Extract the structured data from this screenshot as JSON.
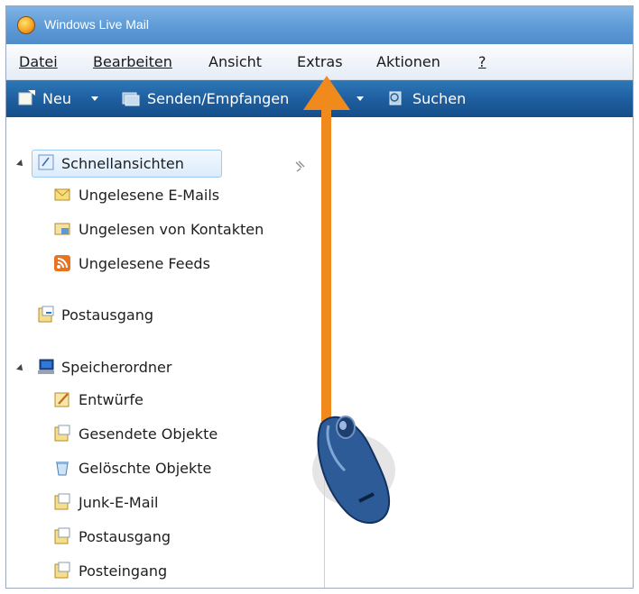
{
  "window": {
    "title": "Windows Live Mail"
  },
  "menu": {
    "items": [
      {
        "label": "Datei",
        "underline": 0
      },
      {
        "label": "Bearbeiten",
        "underline": 0
      },
      {
        "label": "Ansicht",
        "underline": 0
      },
      {
        "label": "Extras",
        "underline": 0
      },
      {
        "label": "Aktionen",
        "underline": 3
      },
      {
        "label": "?",
        "underline": 0
      }
    ]
  },
  "toolbar": {
    "new_label": "Neu",
    "send_receive_label": "Senden/Empfangen",
    "search_label": "Suchen"
  },
  "sidebar": {
    "quick_views": {
      "label": "Schnellansichten",
      "items": [
        "Ungelesene E-Mails",
        "Ungelesen von Kontakten",
        "Ungelesene Feeds"
      ]
    },
    "outbox_label": "Postausgang",
    "storage": {
      "label": "Speicherordner",
      "items": [
        "Entwürfe",
        "Gesendete Objekte",
        "Gelöschte Objekte",
        "Junk-E-Mail",
        "Postausgang",
        "Posteingang"
      ]
    }
  },
  "colors": {
    "annotation_arrow": "#f08a1c",
    "toolbar": "#1f5fa0"
  }
}
